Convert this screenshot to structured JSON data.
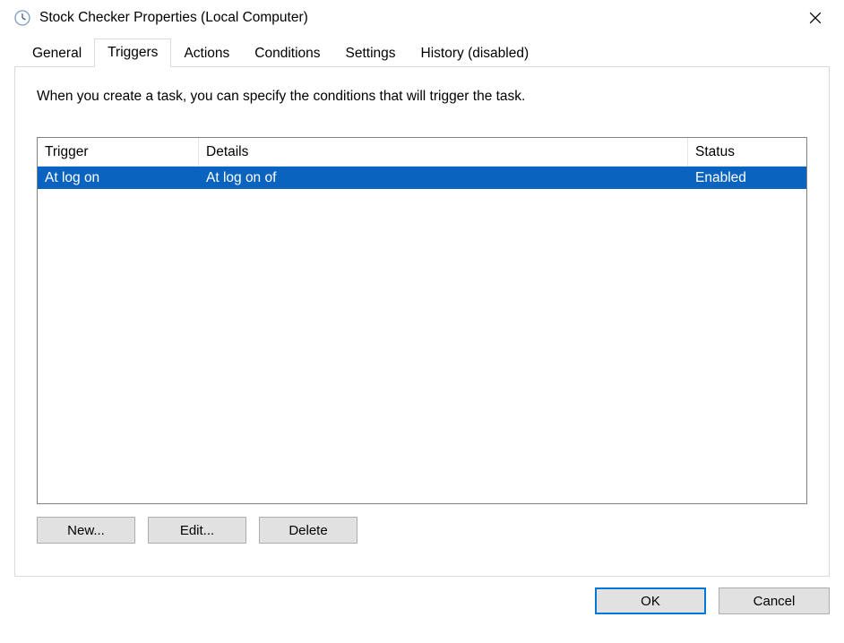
{
  "window": {
    "title": "Stock Checker Properties (Local Computer)"
  },
  "tabs": [
    {
      "label": "General"
    },
    {
      "label": "Triggers"
    },
    {
      "label": "Actions"
    },
    {
      "label": "Conditions"
    },
    {
      "label": "Settings"
    },
    {
      "label": "History (disabled)"
    }
  ],
  "active_tab_index": 1,
  "panel": {
    "description": "When you create a task, you can specify the conditions that will trigger the task."
  },
  "table": {
    "headers": {
      "trigger": "Trigger",
      "details": "Details",
      "status": "Status"
    },
    "rows": [
      {
        "trigger": "At log on",
        "details": "At log on of",
        "status": "Enabled"
      }
    ]
  },
  "buttons": {
    "new": "New...",
    "edit": "Edit...",
    "delete": "Delete",
    "ok": "OK",
    "cancel": "Cancel"
  }
}
